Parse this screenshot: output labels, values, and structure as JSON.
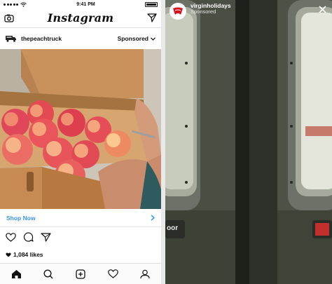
{
  "left": {
    "status": {
      "time": "9:41 PM"
    },
    "header": {
      "logo": "Instagram"
    },
    "post": {
      "username": "thepeachtruck",
      "sponsored_label": "Sponsored"
    },
    "cta": {
      "label": "Shop Now"
    },
    "likes": {
      "text": "1,084 likes"
    },
    "tabs": [
      "home-icon",
      "search-icon",
      "add-icon",
      "heart-icon",
      "profile-icon"
    ]
  },
  "right": {
    "story": {
      "username": "virginholidays",
      "sponsored_label": "Sponsored"
    },
    "door_sign": "oor"
  },
  "colors": {
    "link_blue": "#3897f0",
    "virgin_red": "#d6111a"
  }
}
